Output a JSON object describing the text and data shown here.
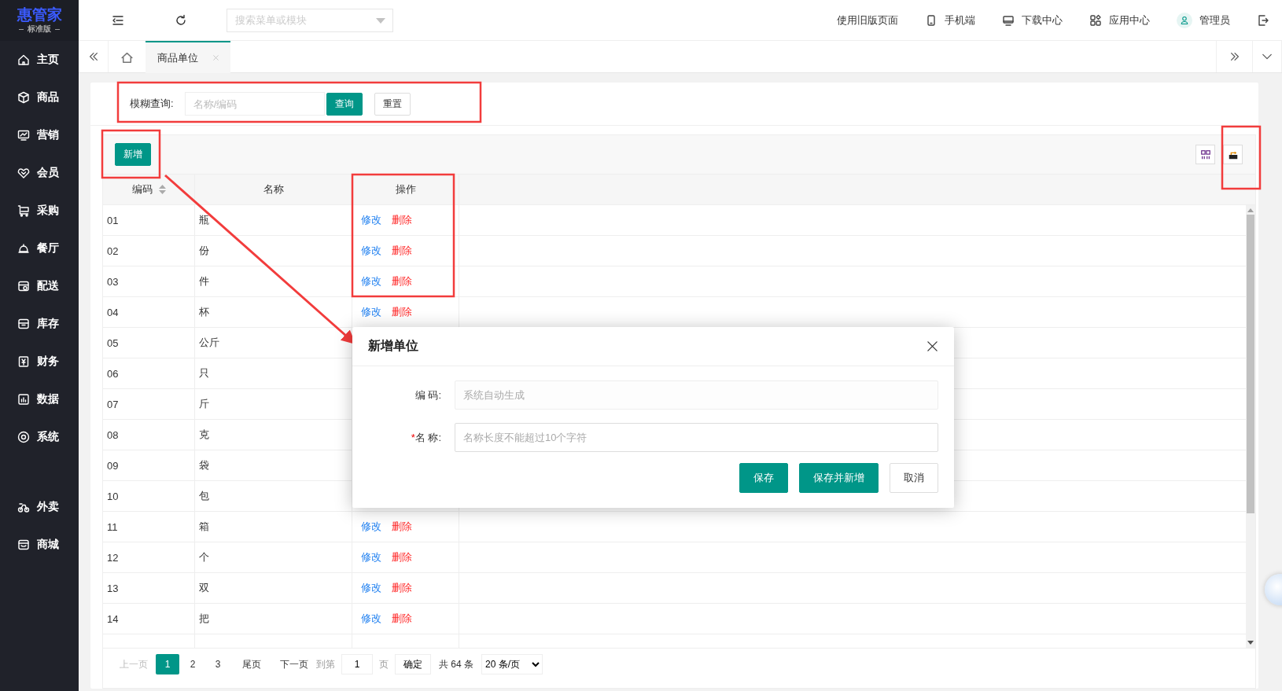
{
  "sidebar": {
    "logo": "惠管家",
    "edition": "标准版",
    "items": [
      {
        "label": "主页"
      },
      {
        "label": "商品"
      },
      {
        "label": "营销"
      },
      {
        "label": "会员"
      },
      {
        "label": "采购"
      },
      {
        "label": "餐厅"
      },
      {
        "label": "配送"
      },
      {
        "label": "库存"
      },
      {
        "label": "财务"
      },
      {
        "label": "数据"
      },
      {
        "label": "系统"
      }
    ],
    "apps": [
      {
        "label": "外卖"
      },
      {
        "label": "商城"
      }
    ]
  },
  "topbar": {
    "search": {
      "placeholder": "搜索菜单或模块"
    },
    "links": [
      "使用旧版页面",
      "手机端",
      "下载中心",
      "应用中心",
      "管理员"
    ]
  },
  "tabs": [
    {
      "kind": "home",
      "selected": false
    },
    {
      "kind": "page",
      "label": "商品单位",
      "selected": true
    }
  ],
  "filter": {
    "label": "模糊查询:",
    "placeholder": "名称/编码",
    "buttons": [
      {
        "label": "查询",
        "kind": "primary"
      },
      {
        "label": "重置",
        "kind": "default"
      }
    ]
  },
  "toolbar": {
    "add_button": "新增"
  },
  "table": {
    "columns": [
      {
        "label": "编码",
        "sortable": true
      },
      {
        "label": "名称",
        "sortable": false
      },
      {
        "label": "操作",
        "sortable": false
      }
    ],
    "rows": [
      {
        "code": "01",
        "name": "瓶",
        "actions": [
          "修改",
          "删除"
        ]
      },
      {
        "code": "02",
        "name": "份",
        "actions": [
          "修改",
          "删除"
        ]
      },
      {
        "code": "03",
        "name": "件",
        "actions": [
          "修改",
          "删除"
        ]
      },
      {
        "code": "04",
        "name": "杯",
        "actions": [
          "修改",
          "删除"
        ]
      },
      {
        "code": "05",
        "name": "公斤"
      },
      {
        "code": "06",
        "name": "只"
      },
      {
        "code": "07",
        "name": "斤"
      },
      {
        "code": "08",
        "name": "克"
      },
      {
        "code": "09",
        "name": "袋"
      },
      {
        "code": "10",
        "name": "包"
      },
      {
        "code": "11",
        "name": "箱",
        "actions": [
          "修改",
          "删除"
        ]
      },
      {
        "code": "12",
        "name": "个",
        "actions": [
          "修改",
          "删除"
        ]
      },
      {
        "code": "13",
        "name": "双",
        "actions": [
          "修改",
          "删除"
        ]
      },
      {
        "code": "14",
        "name": "把",
        "actions": [
          "修改",
          "删除"
        ]
      }
    ]
  },
  "pagination": {
    "prev": {
      "label": "上一页",
      "disabled": true
    },
    "pages": [
      {
        "label": "1",
        "selected": true
      },
      {
        "label": "2",
        "selected": false
      },
      {
        "label": "3",
        "selected": false
      }
    ],
    "last": "尾页",
    "next": "下一页",
    "goto_label": "到第",
    "goto_value": "1",
    "page_unit": "页",
    "confirm": "确定",
    "total": "共 64 条",
    "page_size": "20 条/页"
  },
  "dialog": {
    "title": "新增单位",
    "fields": [
      {
        "label": "编 码:",
        "placeholder": "系统自动生成",
        "disabled": true
      },
      {
        "required_mark": "*",
        "label": "名 称:",
        "placeholder": "名称长度不能超过10个字符",
        "disabled": false
      }
    ],
    "buttons": [
      {
        "label": "保存",
        "kind": "primary"
      },
      {
        "label": "保存并新增",
        "kind": "primary"
      },
      {
        "label": "取消",
        "kind": "default"
      }
    ]
  }
}
